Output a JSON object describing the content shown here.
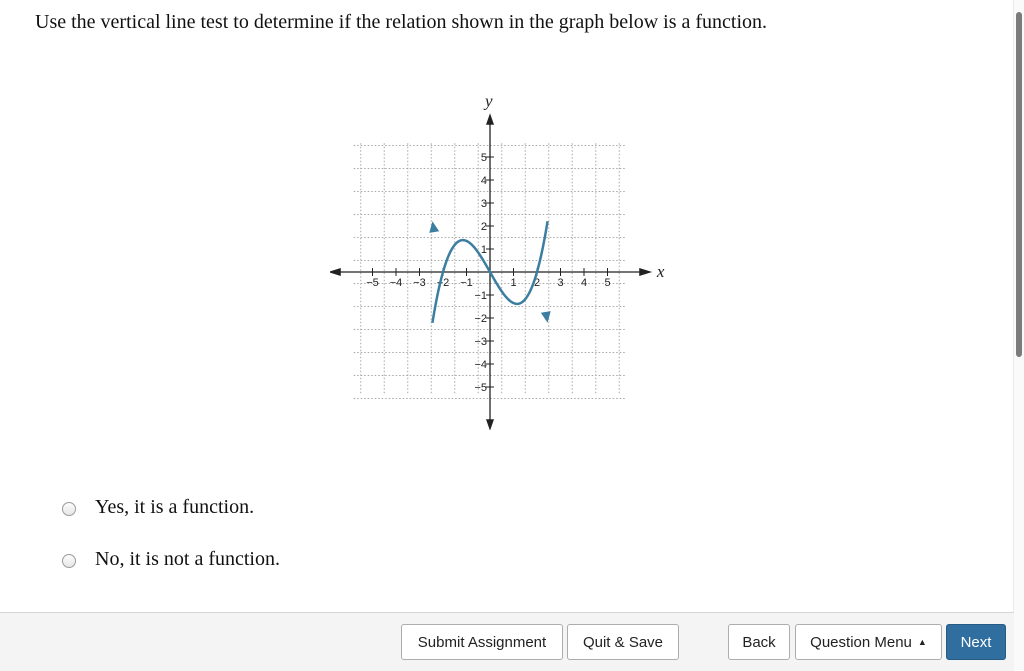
{
  "question": {
    "text": "Use the vertical line test to determine if the relation shown in the graph below is a function."
  },
  "graph": {
    "x_axis_label": "x",
    "y_axis_label": "y",
    "x_ticks": [
      "−5",
      "−4",
      "−3",
      "−2",
      "−1",
      "1",
      "2",
      "3",
      "4",
      "5"
    ],
    "y_ticks": [
      "5",
      "4",
      "3",
      "2",
      "1",
      "−1",
      "−2",
      "−3",
      "−4",
      "−5"
    ],
    "curve_color": "#3b7ea1"
  },
  "choices": [
    {
      "label": "Yes, it is a function.",
      "selected": false
    },
    {
      "label": "No, it is not a function.",
      "selected": false
    }
  ],
  "footer": {
    "submit_label": "Submit Assignment",
    "quit_label": "Quit & Save",
    "back_label": "Back",
    "menu_label": "Question Menu",
    "menu_caret": "▲",
    "next_label": "Next",
    "next_color": "#2f6e9f"
  }
}
